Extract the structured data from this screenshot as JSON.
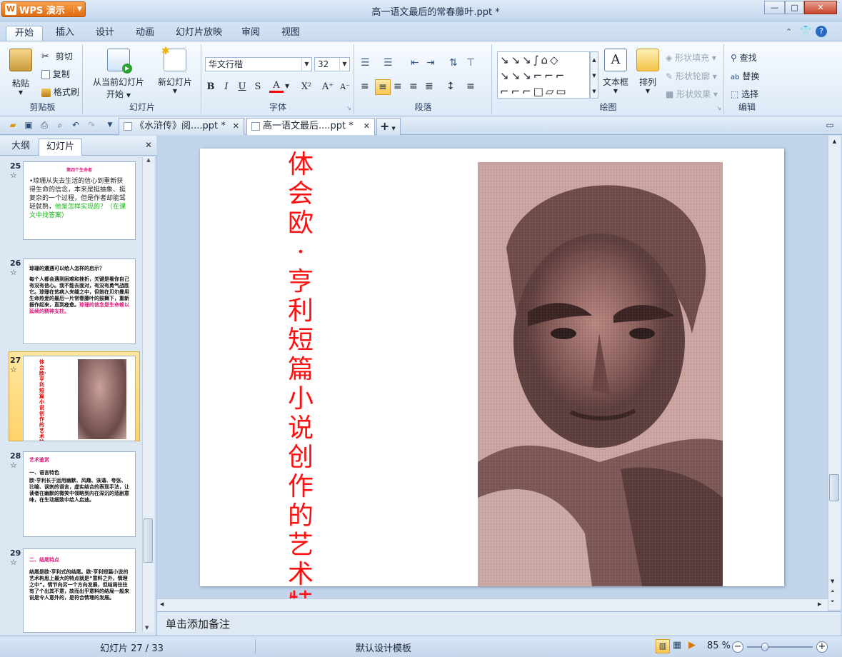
{
  "window": {
    "app_name": "WPS 演示",
    "title": "高一语文最后的常春藤叶.ppt *",
    "bg_tab_1": "《水浒传》阅读...",
    "bg_tab_2": "高一语文最后的常春藤叶...",
    "btn_minimize": "—",
    "btn_restore": "□",
    "btn_close": "✕"
  },
  "ribbon_tabs": [
    "开始",
    "插入",
    "设计",
    "动画",
    "幻灯片放映",
    "审阅",
    "视图"
  ],
  "clipboard": {
    "paste": "粘贴",
    "cut": "剪切",
    "copy": "复制",
    "format_painter": "格式刷",
    "group": "剪贴板"
  },
  "slides_group": {
    "from_current_1": "从当前幻灯片",
    "from_current_2": "开始",
    "new_slide": "新幻灯片",
    "group": "幻灯片"
  },
  "font": {
    "family": "华文行楷",
    "size": "32",
    "group": "字体"
  },
  "paragraph": {
    "group": "段落"
  },
  "drawing": {
    "textbox": "文本框",
    "arrange": "排列",
    "shape_fill": "形状填充",
    "shape_outline": "形状轮廓",
    "shape_effect": "形状效果",
    "group": "绘图"
  },
  "editing": {
    "find": "查找",
    "replace": "替换",
    "select": "选择",
    "group": "编辑"
  },
  "doc_tabs": [
    {
      "label": "《水浒传》阅....ppt *"
    },
    {
      "label": "高一语文最后....ppt *"
    }
  ],
  "panel": {
    "tab_outline": "大纲",
    "tab_slides": "幻灯片"
  },
  "thumbnails": [
    {
      "num": "25",
      "title": "第四个生命者",
      "body": "•琼珊从失去生活的信心到重新获得生命的信念，本来是挺抽象、挺复杂的一个过程，但是作者却能驾轻就熟，",
      "green": "他是怎样实现的？（在课文中找答案）"
    },
    {
      "num": "26",
      "title": "琼珊的遭遇可以给人怎样的启示？",
      "body": "每个人都会遇到困难和挫折，关键是看你自己有没有信心。我不能去面对，有没有勇气战胜它。琼珊在贫病入夹缝之中，但她在贝尔曼用生命热爱的最后一片常春藤叶的鼓舞下，重新振作起来，直到痊愈。",
      "pink": "琼珊的信念是生命赖以延续的精神支柱。"
    },
    {
      "num": "27",
      "vtitle": "体会欧·亨利短篇小说创作的艺术特点"
    },
    {
      "num": "28",
      "title": "艺术鉴赏",
      "sub": "一、语言特色",
      "body": "欧·亨利长于运用幽默、风趣、诙谐、夸张、比喻、讽刺的语言，虚实结合的表现手法，让读者在幽默的微笑中领略到内在深沉的悲剧意味，在生动细致中给人启迪。"
    },
    {
      "num": "29",
      "title": "二、结尾特点",
      "body": "结尾是欧·亨利式的结尾。欧·亨利短篇小说的艺术构思上最大的特点就是“意料之外，情理之中”。情节向另一个方向发展，但结局往往有了个出其不意，故而出乎意料的结局一般来说是令人意外的，是符合情理的发展。"
    }
  ],
  "star_glyph": "☆",
  "slide": {
    "title": "体会欧·亨利短篇小说创作的艺术特点"
  },
  "notes_placeholder": "单击添加备注",
  "status": {
    "slide_info": "幻灯片 27 / 33",
    "template": "默认设计模板",
    "zoom": "85 %",
    "zoom_value": 85
  },
  "colors": {
    "title_red": "#ff1010",
    "thumb_green": "#18b418",
    "thumb_pink": "#e0187c",
    "thumb_red": "#e00000",
    "selection": "#ffd36a"
  }
}
